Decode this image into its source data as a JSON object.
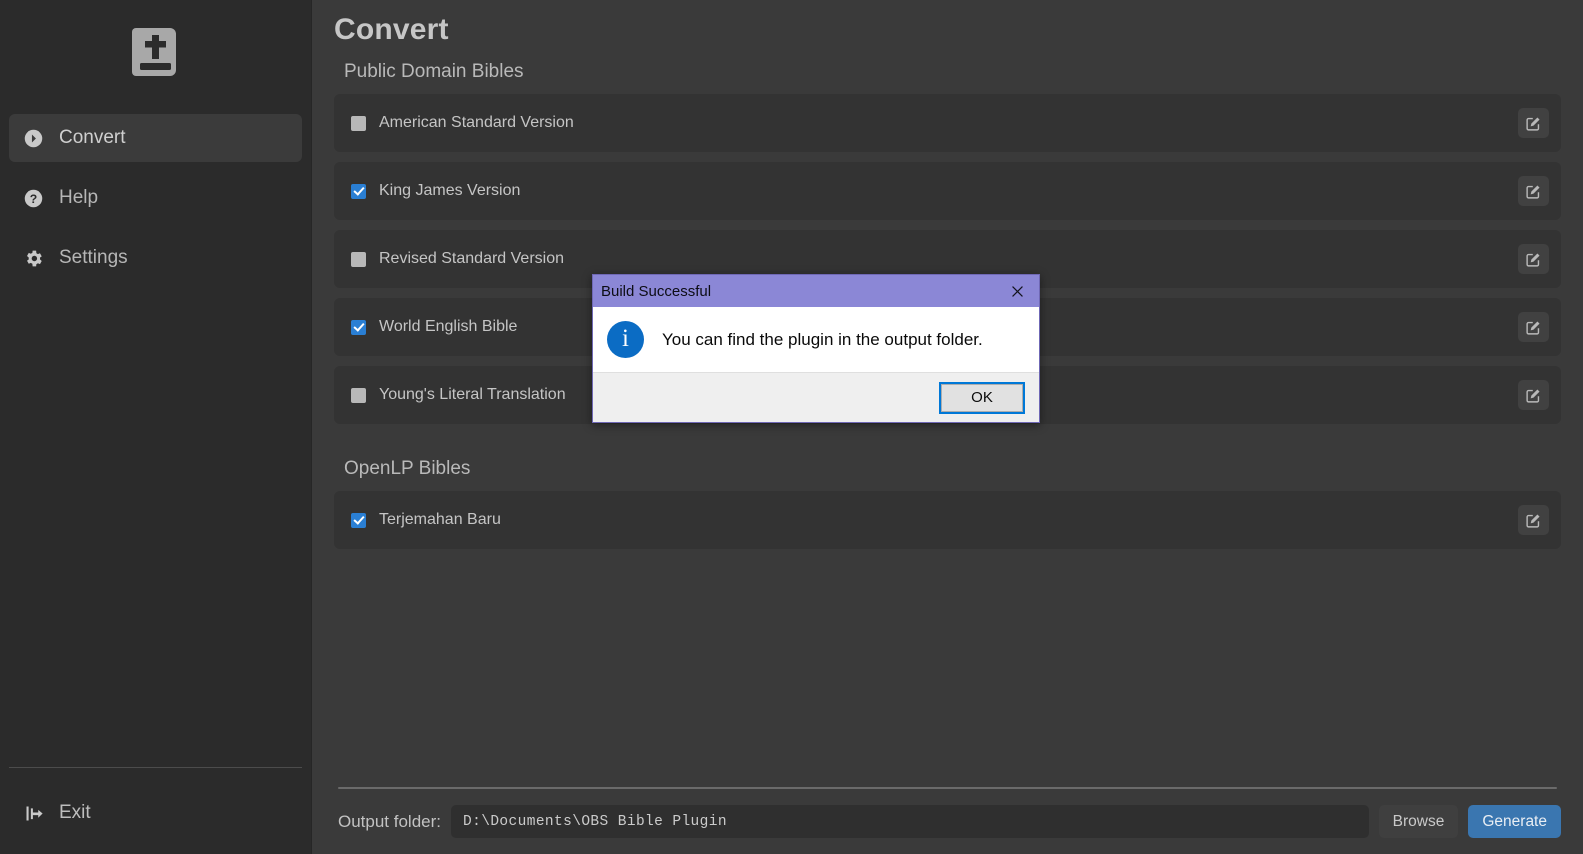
{
  "sidebar": {
    "logo": "bible-book-icon",
    "items": [
      {
        "id": "convert",
        "label": "Convert",
        "icon": "chevron-circle-right-icon",
        "active": true
      },
      {
        "id": "help",
        "label": "Help",
        "icon": "question-circle-icon",
        "active": false
      },
      {
        "id": "settings",
        "label": "Settings",
        "icon": "gear-icon",
        "active": false
      }
    ],
    "exit": {
      "label": "Exit",
      "icon": "sign-out-icon"
    }
  },
  "main": {
    "page_title": "Convert",
    "sections": [
      {
        "id": "public-domain",
        "title": "Public Domain Bibles",
        "rows": [
          {
            "label": "American Standard Version",
            "checked": false
          },
          {
            "label": "King James Version",
            "checked": true
          },
          {
            "label": "Revised Standard Version",
            "checked": false
          },
          {
            "label": "World English Bible",
            "checked": true
          },
          {
            "label": "Young's Literal Translation",
            "checked": false
          }
        ]
      },
      {
        "id": "openlp",
        "title": "OpenLP Bibles",
        "rows": [
          {
            "label": "Terjemahan Baru",
            "checked": true
          }
        ]
      }
    ],
    "row_edit_icon": "edit-pencil-square-icon"
  },
  "bottom_bar": {
    "output_label": "Output folder:",
    "output_path": "D:\\Documents\\OBS Bible Plugin",
    "output_placeholder": "D:\\Documents\\OBS Bible Plugin",
    "browse_label": "Browse",
    "generate_label": "Generate"
  },
  "dialog": {
    "title": "Build Successful",
    "close_icon": "close-x-icon",
    "info_icon": "info-circle-icon",
    "info_glyph": "i",
    "message": "You can find the plugin in the output folder.",
    "ok_label": "OK"
  },
  "colors": {
    "sidebar_bg": "#2b2b2b",
    "main_bg": "#3a3a3a",
    "row_bg": "#333333",
    "accent_blue": "#2a7fd4",
    "generate_blue": "#3a76b0",
    "dialog_titlebar": "#8b87d6",
    "info_blue": "#0b6cc4",
    "focus_blue": "#0078d7"
  }
}
